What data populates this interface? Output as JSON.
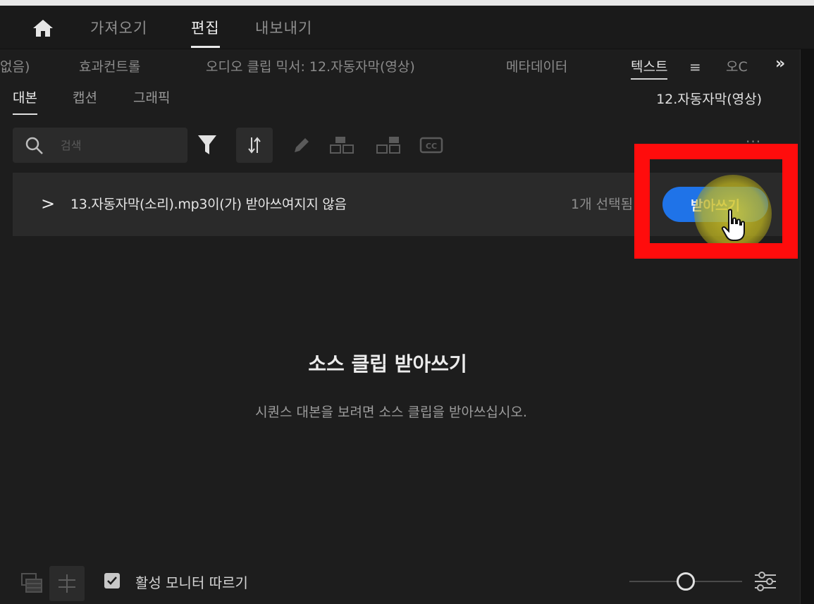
{
  "workspace": {
    "tabs": [
      {
        "label": "가져오기",
        "active": false
      },
      {
        "label": "편집",
        "active": true
      },
      {
        "label": "내보내기",
        "active": false
      }
    ]
  },
  "panel_tabs": [
    {
      "label": "없음)"
    },
    {
      "label": "효과컨트롤"
    },
    {
      "label": "오디오 클립 믹서: 12.자동자막(영상)"
    },
    {
      "label": "메타데이터"
    },
    {
      "label": "텍스트",
      "active": true
    },
    {
      "label": "오C"
    }
  ],
  "text_panel": {
    "sub_tabs": [
      {
        "label": "대본",
        "active": true
      },
      {
        "label": "캡션"
      },
      {
        "label": "그래픽"
      }
    ],
    "sequence_name": "12.자동자막(영상)",
    "search": {
      "placeholder": "검색",
      "value": ""
    },
    "clip_row": {
      "name": "13.자동자막(소리).mp3이(가) 받아쓰여지지 않음",
      "selection": "1개 선택됨",
      "button_label": "받아쓰기"
    },
    "empty_state": {
      "title": "소스 클립 받아쓰기",
      "description": "시퀀스 대본을 보려면 소스 클립을 받아쓰십시오."
    },
    "footer": {
      "follow_monitor_label": "활성 모니터 따르기",
      "follow_monitor_checked": true,
      "zoom_level": 0.5
    }
  },
  "colors": {
    "accent": "#1f73e8",
    "highlight": "#ff0c0c",
    "background": "#1d1d1d"
  }
}
